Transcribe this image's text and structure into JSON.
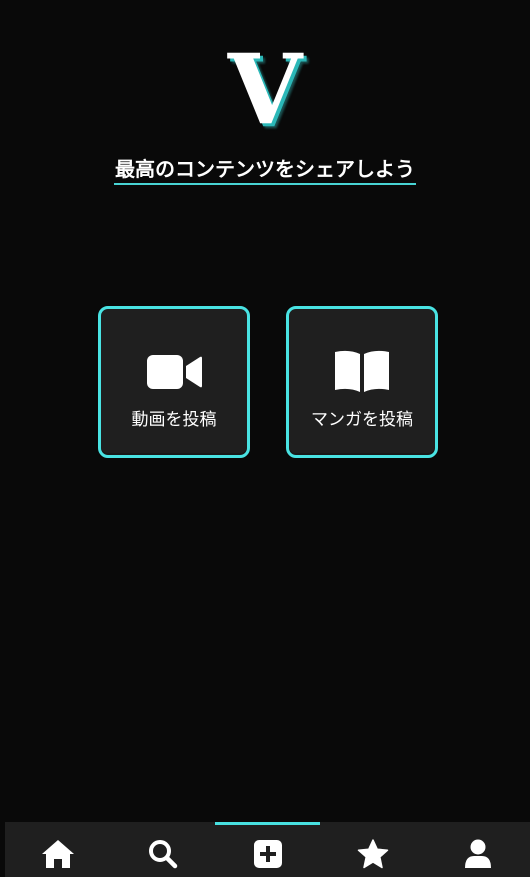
{
  "brand": {
    "logo_letter": "V",
    "tagline": "最高のコンテンツをシェアしよう",
    "accent_color": "#48e0e0"
  },
  "post_options": [
    {
      "id": "video",
      "label": "動画を投稿",
      "icon": "video-camera-icon"
    },
    {
      "id": "manga",
      "label": "マンガを投稿",
      "icon": "open-book-icon"
    }
  ],
  "bottom_nav": {
    "items": [
      {
        "id": "home",
        "icon": "home-icon",
        "active": false
      },
      {
        "id": "search",
        "icon": "search-icon",
        "active": false
      },
      {
        "id": "post",
        "icon": "plus-square-icon",
        "active": true
      },
      {
        "id": "favorites",
        "icon": "star-icon",
        "active": false
      },
      {
        "id": "profile",
        "icon": "user-icon",
        "active": false
      }
    ]
  }
}
